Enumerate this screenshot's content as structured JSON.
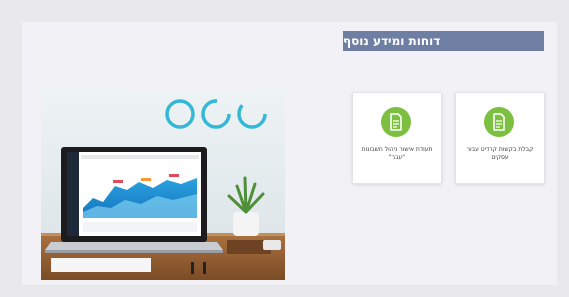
{
  "section": {
    "title": "דוחות ומידע נוסף"
  },
  "cards": [
    {
      "label": "קבלת בקשות קרדיט עבור עסקים",
      "icon": "document-icon"
    },
    {
      "label": "תעודת אישור ניהול חשבונות \"עבר\"",
      "icon": "document-icon"
    }
  ],
  "colors": {
    "page_bg": "#e9e9ec",
    "panel_bg": "#f1f1f6",
    "header_bar": "#6f7fa3",
    "icon_green": "#7dc041",
    "ring_blue": "#35b7d6"
  }
}
